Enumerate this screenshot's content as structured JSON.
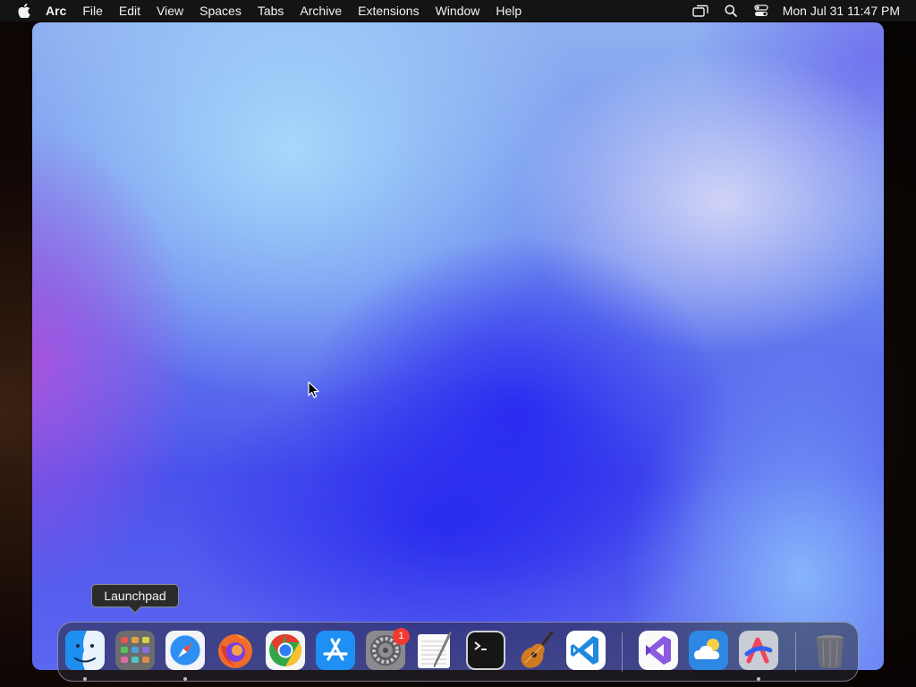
{
  "menubar": {
    "app_name": "Arc",
    "items": [
      "File",
      "Edit",
      "View",
      "Spaces",
      "Tabs",
      "Archive",
      "Extensions",
      "Window",
      "Help"
    ],
    "clock": "Mon Jul 31  11:47 PM",
    "status_icons": [
      "screen-mirroring-icon",
      "search-icon",
      "control-center-icon"
    ]
  },
  "tooltip": {
    "text": "Launchpad"
  },
  "dock": {
    "apps": [
      {
        "name": "Finder",
        "icon": "finder-icon",
        "running": true
      },
      {
        "name": "Launchpad",
        "icon": "launchpad-icon",
        "running": false
      },
      {
        "name": "Safari",
        "icon": "safari-icon",
        "running": true
      },
      {
        "name": "Firefox",
        "icon": "firefox-icon",
        "running": false
      },
      {
        "name": "Google Chrome",
        "icon": "chrome-icon",
        "running": false
      },
      {
        "name": "App Store",
        "icon": "app-store-icon",
        "running": false
      },
      {
        "name": "System Settings",
        "icon": "system-settings-icon",
        "running": false,
        "badge": "1"
      },
      {
        "name": "TextEdit",
        "icon": "textedit-icon",
        "running": false
      },
      {
        "name": "Terminal",
        "icon": "terminal-icon",
        "running": false
      },
      {
        "name": "GarageBand",
        "icon": "garageband-icon",
        "running": false
      },
      {
        "name": "Visual Studio Code",
        "icon": "vscode-icon",
        "running": false
      },
      {
        "name": "Visual Studio",
        "icon": "visual-studio-icon",
        "running": false
      },
      {
        "name": "Weather",
        "icon": "weather-icon",
        "running": false
      },
      {
        "name": "Arc",
        "icon": "arc-icon",
        "running": true
      },
      {
        "name": "Trash",
        "icon": "trash-icon",
        "running": false
      }
    ]
  }
}
